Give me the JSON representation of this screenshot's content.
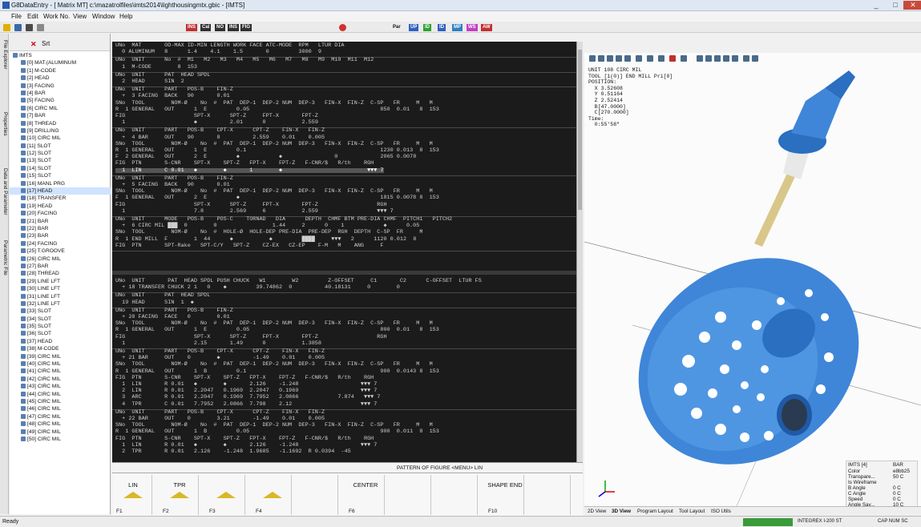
{
  "window": {
    "title": "G8DataEntry - [ Matrix MT] c:\\mazatrolfiles\\imts2014\\lighthousingmtx.gbic - [IMTS]",
    "controls": [
      "_",
      "□",
      "✕"
    ]
  },
  "menu": [
    "File",
    "Edit",
    "Work No.",
    "View",
    "Window",
    "Help"
  ],
  "toolbar_labels": [
    "INS",
    "Cal",
    "NO",
    "INS",
    "FIG",
    "Par",
    "UP",
    "ID",
    "ID",
    "MP",
    "WS",
    "AW"
  ],
  "left_tabs": [
    "File Explorer",
    "Properties",
    "Data and Parameter",
    "Parametric File"
  ],
  "tree": {
    "search_label": "Srt",
    "items": [
      "IMTS",
      "[0] MAT.(ALUMINUM",
      "[1] M-CODE",
      "[2] HEAD",
      "[3] FACING",
      "[4] BAR",
      "[5] FACING",
      "[6] CIRC MIL",
      "[7] BAR",
      "[8] THREAD",
      "[9] DRILLING",
      "[10] CIRC MIL",
      "[11] SLOT",
      "[12] SLOT",
      "[13] SLOT",
      "[14] SLOT",
      "[15] SLOT",
      "[16] MANL PRG",
      "[17] HEAD",
      "[18] TRANSFER",
      "[19] HEAD",
      "[20] FACING",
      "[21] BAR",
      "[22] BAR",
      "[23] BAR",
      "[24] FACING",
      "[25] T.GROOVE",
      "[26] CIRC MIL",
      "[27] BAR",
      "[28] THREAD",
      "[29] LINE LFT",
      "[30] LINE LFT",
      "[31] LINE LFT",
      "[32] LINE LFT",
      "[33] SLOT",
      "[34] SLOT",
      "[35] SLOT",
      "[36] SLOT",
      "[37] HEAD",
      "[38] M-CODE",
      "[39] CIRC MIL",
      "[40] CIRC MIL",
      "[41] CIRC MIL",
      "[42] CIRC MIL",
      "[43] CIRC MIL",
      "[44] CIRC MIL",
      "[45] CIRC MIL",
      "[46] CIRC MIL",
      "[47] CIRC MIL",
      "[48] CIRC MIL",
      "[49] CIRC MIL",
      "[50] CIRC MIL"
    ]
  },
  "console": {
    "lines": [
      "UNo  MAT       OD-MAX ID-MIN LENGTH WORK FACE ATC-MODE  RPM   LTUR DIA",
      "  0 ALUMINUM   8      1.4    4.1    1.5       0         3000  9",
      "UNo  UNIT      No  #  M1   M2   M3   M4   M5   M6   M7   M8   M9  M10  M11  M12",
      "  1  M-CODE        8  153",
      "UNo  UNIT      PAT  HEAD SPDL",
      "  2  HEAD      SIN  2",
      "UNo  UNIT      PART   POS-B    FIN-Z",
      "  +  3 FACING  BACK   90       0.01",
      "SNo  TOOL        NOM-Ø    No  #  PAT  DEP-1  DEP-2 NUM  DEP-3   FIN-X  FIN-Z  C-SP   FR     M   M",
      "R  1 GENERAL   OUT      1  E         0.05                                        850  0.01   8  153",
      "FIG                     SPT-X      SPT-Z     FPT-X       FPT-Z",
      "  1                     ◆          2.01      0           2.559",
      "UNo  UNIT      PART   POS-B    CPT-X      CPT-Z    FIN-X   FIN-Z",
      "  +  4 BAR     OUT    90       8          2.559    0.01    0.005",
      "SNo  TOOL        NOM-Ø    No  #  PAT  DEP-1  DEP-2 NUM  DEP-3   FIN-X  FIN-Z  C-SP   FR     M   M",
      "R  1 GENERAL   OUT      1  E         0.1                                         1230 0.013  8  153",
      "F  2 GENERAL   OUT      2  E         ◆            ◆                0             2065 0.0078",
      "FIG  PTN       S-CNR    SPT-X    SPT-Z   FPT-X    FPT-Z   F-CNR/$   R/th    RGH",
      "  1  LIN       C 0.01   ◆        ◆       1        ◆                          ▼▼▼ 7",
      "UNo  UNIT      PART   POS-B    FIN-Z",
      "  +  5 FACING  BACK   90       0.01",
      "SNo  TOOL        NOM-Ø    No  #  PAT  DEP-1  DEP-2 NUM  DEP-3   FIN-X  FIN-Z  C-SP   FR     M   M",
      "F  1 GENERAL   OUT      2  E         ◆                                           1815 0.0078 8  153",
      "FIG                     SPT-X      SPT-Z     FPT-X       FPT-Z                  RGH",
      "  1                     7.8        2.569     6           2.559                  ▼▼▼ 7",
      "UNo  UNIT      MODE   POS-B    POS-C    TORNAD   DIA      DEPTH  CHMF BTM PRE-DIA CHMF  PITCH1   PITCH2",
      "  +  6 CIRC MIL ███  0        0                 1.44     2      0    1            ◆      0.05",
      "SNo  TOOL        NOM-Ø    No  #  HOLE-Ø  HOLE-DEP PRE-DIA  PRE-DEP  RGH  DEPTH  C-SP  FR     M",
      "R  1 END MILL  F        1  44      ◆           ◆         ████     ▼▼▼   2      1120 0.012  8",
      "FIG  PTN       SPT-Rake   SPT-C/Y   SPT-Z    CZ-EX   CZ-EP    F-M   M    ANG     F",
      "UNo  UNIT       PAT  HEAD SPDL PUSH CHUCK   W1        W2         Z-OFFSET     C1       C2      C-OFFSET  LTUR FS",
      "  + 18 TRANSFER CHUCK 2 1   0    ◆         39.74862  0          40.18131     0        0",
      "UNo  UNIT      PAT  HEAD SPDL",
      "  19 HEAD      SIN  1  ◆",
      "UNo  UNIT      PART   POS-B    FIN-Z",
      "  + 20 FACING  FACE   0        0.01",
      "SNo  TOOL        NOM-Ø    No  #  PAT  DEP-1  DEP-2 NUM  DEP-3   FIN-X  FIN-Z  C-SP   FR     M   M",
      "R  1 GENERAL   OUT      1  E         0.05                                        800  0.01   8  153",
      "FIG                     SPT-X      SPT-Z     FPT-X       FPT-Z                  RGH",
      "  1                     2.15       1.49      0           1.3858",
      "UNo  UNIT      PART   POS-B    CPT-X      CPT-Z    FIN-X   FIN-Z",
      "  + 21 BAR     OUT    0        ◆          -1.49    0.01    0.005",
      "SNo  TOOL        NOM-Ø    No  #  PAT  DEP-1  DEP-2 NUM  DEP-3   FIN-X  FIN-Z  C-SP   FR     M   M",
      "R  1 GENERAL   OUT      1  B         0.1                                         900  0.0143 8  153",
      "FIG  PTN       S-CNR    SPT-X    SPT-Z   FPT-X    FPT-Z   F-CNR/$   R/th    RGH",
      "  1  LIN       R 0.01   ◆        ◆       2.126    -1.248                   ▼▼▼ 7",
      "  2  LIN       R 0.01   2.2047   0.1969  2.2047   0.1969                   ▼▼▼ 7",
      "  3  ARC       R 0.01   2.2047   0.1969  7.7952   2.0866            7.874   ▼▼▼ 7",
      "  4  TPR       C 0.01   7.7952   2.0866  7.798    2.12                     ▼▼▼ 7",
      "UNo  UNIT      PART   POS-B    CPT-X      CPT-Z    FIN-X   FIN-Z",
      "  + 22 BAR     OUT    0        3.21       -1.49    0.01    0.005",
      "SNo  TOOL        NOM-Ø    No  #  PAT  DEP-1  DEP-2 NUM  DEP-3   FIN-X  FIN-Z  C-SP   FR     M   M",
      "R  1 GENERAL   OUT      1  B         0.05                                        900  0.011  8  153",
      "FIG  PTN       S-CNR    SPT-X    SPT-Z   FPT-X    FPT-Z   F-CNR/$   R/th    RGH",
      "  1  LIN       R 0.01   ◆        ◆       2.126    -1.248                   ▼▼▼ 7",
      "  2  TPR       R 0.01   2.126    -1.248  1.9685   -1.1692  R 0.0394  -45"
    ]
  },
  "status_line": "PATTERN OF FIGURE <MENU>   LIN",
  "fkeys": [
    {
      "label": "LIN",
      "num": "F1"
    },
    {
      "label": "TPR",
      "num": "F2"
    },
    {
      "label": "",
      "num": "F3"
    },
    {
      "label": "",
      "num": "F4"
    },
    {
      "label": "",
      "num": ""
    },
    {
      "label": "CENTER",
      "num": "F6"
    },
    {
      "label": "",
      "num": ""
    },
    {
      "label": "",
      "num": ""
    },
    {
      "label": "SHAPE END",
      "num": "F10"
    },
    {
      "label": "",
      "num": ""
    }
  ],
  "readout": [
    "UNIT 108 CIRC MIL",
    "TOOL [1(0)] END MILL Pri[0]",
    "POSITION:",
    "  X 3.52608",
    "  Y 0.51164",
    "  Z 2.52414",
    "  B[47.0000]",
    "  C[270.0000]",
    "Time:",
    "  0:55'58\""
  ],
  "props": {
    "header": "IMTS [4]",
    "header2": "BAR",
    "rows": [
      {
        "k": "Color",
        "v": "e8bb25"
      },
      {
        "k": "Transpare...",
        "v": "50 C"
      },
      {
        "k": "Is Wireframe",
        "v": ""
      },
      {
        "k": "B Angle",
        "v": "0 C"
      },
      {
        "k": "C Angle",
        "v": "0 C"
      },
      {
        "k": "Speed",
        "v": "0 C"
      },
      {
        "k": "Angle Sav...",
        "v": "10 C"
      }
    ]
  },
  "bottom_tabs": [
    "2D View",
    "3D View",
    "Program Layout",
    "Tool Layout",
    "ISO Utils"
  ],
  "statusbar": {
    "left": "Ready",
    "green": "",
    "mid": "INTEGREX I-200 ST",
    "right": "CAP  NUM  SC"
  },
  "colors": {
    "console_bg": "#1b1b1b",
    "part_blue": "#3f86d8",
    "accent": "#ff66cc",
    "tool_yellow": "#d9c78a"
  }
}
